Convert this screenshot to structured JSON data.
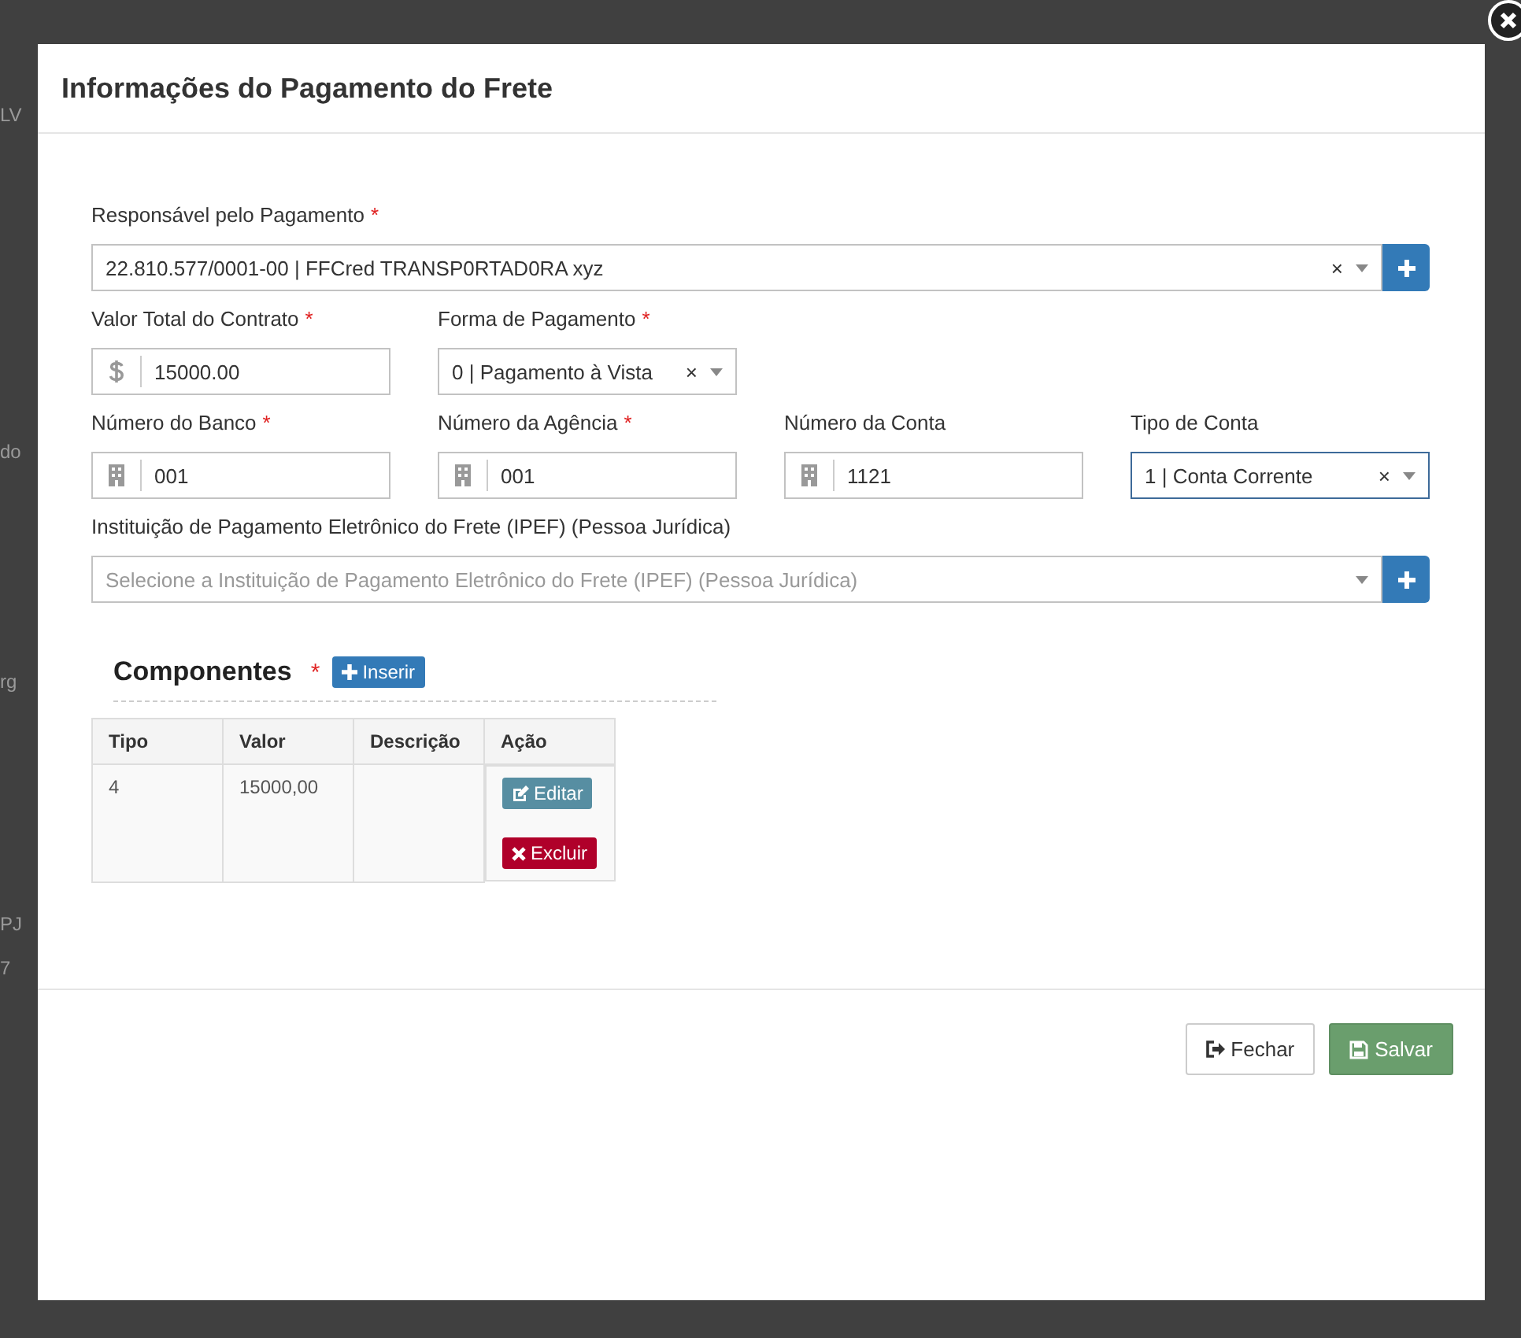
{
  "background_fragments": [
    "LV",
    "do",
    "rg",
    "PJ",
    "7"
  ],
  "modal": {
    "title": "Informações do Pagamento do Frete"
  },
  "form_rows": [
    [
      {
        "kind": "select",
        "label": "Responsável pelo Pagamento",
        "required_mark": "*",
        "value": "22.810.577/0001-00 | FFCred TRANSP0RTAD0RA xyz",
        "clear": "×",
        "add_button": true,
        "focused": false
      }
    ],
    [
      {
        "kind": "money-input",
        "label": "Valor Total do Contrato",
        "required_mark": "*",
        "value": "15000.00"
      },
      {
        "kind": "select",
        "label": "Forma de Pagamento",
        "required_mark": "*",
        "value": "0 | Pagamento à Vista",
        "clear": "×",
        "add_button": false,
        "focused": false
      }
    ],
    [
      {
        "kind": "bank-input",
        "label": "Número do Banco",
        "required_mark": "*",
        "value": "001"
      },
      {
        "kind": "bank-input",
        "label": "Número da Agência",
        "required_mark": "*",
        "value": "001"
      },
      {
        "kind": "bank-input",
        "label": "Número da Conta",
        "value": "1121"
      },
      {
        "kind": "select",
        "label": "Tipo de Conta",
        "value": "1 | Conta Corrente",
        "clear": "×",
        "add_button": false,
        "focused": true
      }
    ],
    [
      {
        "kind": "select",
        "label": "Instituição de Pagamento Eletrônico do Frete (IPEF) (Pessoa Jurídica)",
        "placeholder": "Selecione a Instituição de Pagamento Eletrônico do Frete (IPEF) (Pessoa Jurídica)",
        "add_button": true,
        "focused": false
      }
    ]
  ],
  "components": {
    "title": "Componentes",
    "required_mark": "*",
    "insert_button": "Inserir",
    "columns": [
      "Tipo",
      "Valor",
      "Descrição",
      "Ação"
    ],
    "rows": [
      {
        "tipo": "4",
        "valor": "15000,00",
        "actions": [
          {
            "kind": "edit",
            "label": "Editar"
          },
          {
            "kind": "delete",
            "label": "Excluir"
          }
        ]
      }
    ]
  },
  "footer_buttons": [
    {
      "kind": "close",
      "label": "Fechar"
    },
    {
      "kind": "save",
      "label": "Salvar"
    }
  ]
}
